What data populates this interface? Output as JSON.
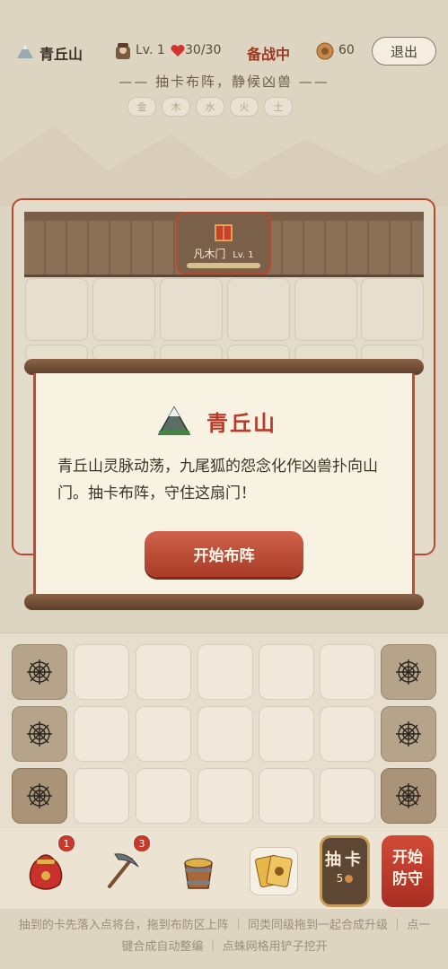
{
  "header": {
    "location_name": "青丘山",
    "level": "Lv. 1",
    "hp": "30/30",
    "status": "备战中",
    "coins": "60",
    "exit_label": "退出"
  },
  "subtitle": "—— 抽卡布阵，静候凶兽 ——",
  "elements": [
    "金",
    "木",
    "水",
    "火",
    "土"
  ],
  "gate": {
    "name": "凡木门",
    "level": "Lv. 1"
  },
  "dialog": {
    "title": "青丘山",
    "body": "青丘山灵脉动荡，九尾狐的怨念化作凶兽扑向山门。抽卡布阵，守住这扇门！",
    "button_label": "开始布阵"
  },
  "toolbar": {
    "bag_badge": "1",
    "pickaxe_badge": "3",
    "draw_label": "抽卡",
    "draw_cost": "5",
    "defend_label": "开始防守"
  },
  "hint": "抽到的卡先落入点将台，拖到布防区上阵 ｜ 同类同级拖到一起合成升级 ｜ 点一键合成自动整编 ｜ 点蛛网格用铲子挖开",
  "colors": {
    "accent_red": "#b9492e",
    "parchment": "#f8f2e3",
    "wood": "#5e4634"
  }
}
